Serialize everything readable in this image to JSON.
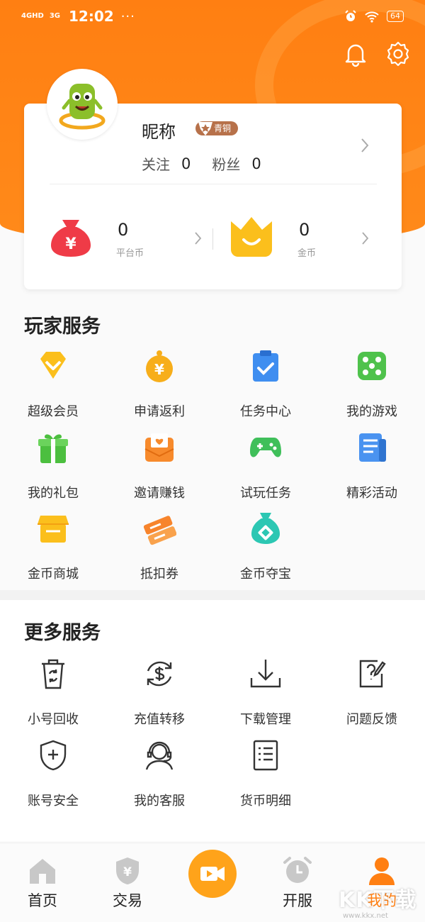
{
  "status_bar": {
    "signal_1": "4GHD",
    "signal_2": "3G",
    "time": "12:02",
    "dots": "···",
    "battery": "64"
  },
  "profile": {
    "nickname": "昵称",
    "level_badge": "青铜",
    "follow_label": "关注",
    "follow_count": "0",
    "fans_label": "粉丝",
    "fans_count": "0"
  },
  "wallet": {
    "platform_coin": {
      "value": "0",
      "label": "平台币"
    },
    "gold_coin": {
      "value": "0",
      "label": "金币"
    }
  },
  "player_services": {
    "title": "玩家服务",
    "items": [
      {
        "label": "超级会员",
        "icon": "diamond-icon",
        "color": "#fbbf1c"
      },
      {
        "label": "申请返利",
        "icon": "yen-bag-icon",
        "color": "#f7ae1a"
      },
      {
        "label": "任务中心",
        "icon": "clipboard-check-icon",
        "color": "#3f8ef0"
      },
      {
        "label": "我的游戏",
        "icon": "dice-icon",
        "color": "#4fc24c"
      },
      {
        "label": "我的礼包",
        "icon": "gift-icon",
        "color": "#4cbf3f"
      },
      {
        "label": "邀请赚钱",
        "icon": "envelope-heart-icon",
        "color": "#f78a2c"
      },
      {
        "label": "试玩任务",
        "icon": "gamepad-icon",
        "color": "#3fbf5a"
      },
      {
        "label": "精彩活动",
        "icon": "newspaper-icon",
        "color": "#4a93f0"
      },
      {
        "label": "金币商城",
        "icon": "shop-icon",
        "color": "#fbbf1c"
      },
      {
        "label": "抵扣券",
        "icon": "ticket-icon",
        "color": "#f7842c"
      },
      {
        "label": "金币夺宝",
        "icon": "treasure-bag-icon",
        "color": "#2cc7b3"
      }
    ]
  },
  "more_services": {
    "title": "更多服务",
    "items": [
      {
        "label": "小号回收",
        "icon": "recycle-bin-icon"
      },
      {
        "label": "充值转移",
        "icon": "dollar-transfer-icon"
      },
      {
        "label": "下载管理",
        "icon": "download-icon"
      },
      {
        "label": "问题反馈",
        "icon": "feedback-icon"
      },
      {
        "label": "账号安全",
        "icon": "shield-plus-icon"
      },
      {
        "label": "我的客服",
        "icon": "headset-icon"
      },
      {
        "label": "货币明细",
        "icon": "list-doc-icon"
      }
    ]
  },
  "tabbar": {
    "home": "首页",
    "trade": "交易",
    "open_server": "开服",
    "mine": "我的"
  },
  "watermark": {
    "big": "KK下载",
    "small": "www.kkx.net"
  },
  "colors": {
    "brand_orange": "#ff7f12",
    "accent_yellow": "#ffa31a"
  }
}
